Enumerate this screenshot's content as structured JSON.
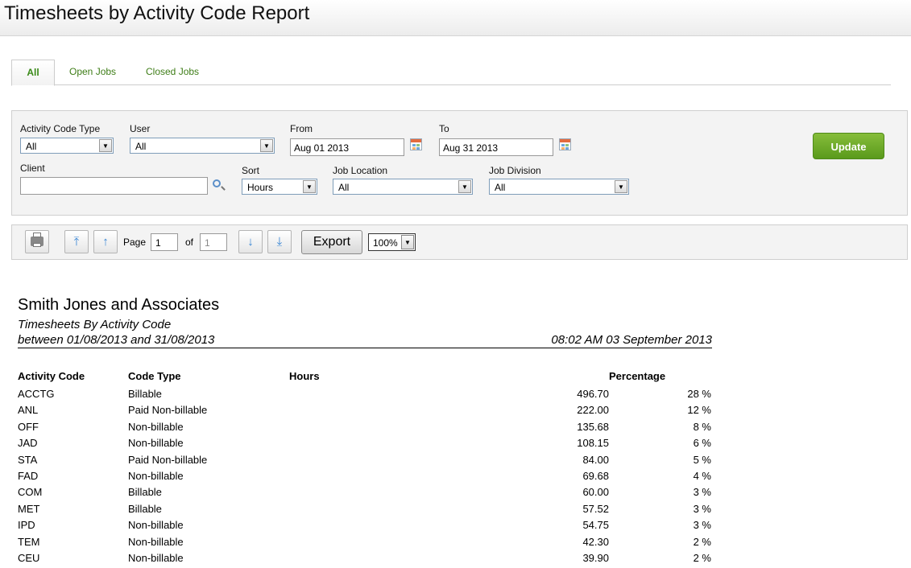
{
  "page": {
    "title": "Timesheets by Activity Code Report"
  },
  "tabs": [
    {
      "label": "All",
      "active": true
    },
    {
      "label": "Open Jobs",
      "active": false
    },
    {
      "label": "Closed Jobs",
      "active": false
    }
  ],
  "filters": {
    "activity_code_type": {
      "label": "Activity Code Type",
      "value": "All"
    },
    "user": {
      "label": "User",
      "value": "All"
    },
    "from": {
      "label": "From",
      "value": "Aug 01 2013"
    },
    "to": {
      "label": "To",
      "value": "Aug 31 2013"
    },
    "client": {
      "label": "Client",
      "value": ""
    },
    "sort": {
      "label": "Sort",
      "value": "Hours"
    },
    "job_location": {
      "label": "Job Location",
      "value": "All"
    },
    "job_division": {
      "label": "Job Division",
      "value": "All"
    },
    "update_label": "Update"
  },
  "toolbar": {
    "page_label": "Page",
    "page_value": "1",
    "of_label": "of",
    "total_pages": "1",
    "export_label": "Export",
    "zoom_value": "100%"
  },
  "report": {
    "company": "Smith Jones and Associates",
    "subtitle": "Timesheets By Activity Code",
    "range": "between 01/08/2013 and 31/08/2013",
    "generated": "08:02 AM 03 September 2013",
    "headers": {
      "activity_code": "Activity Code",
      "code_type": "Code Type",
      "hours": "Hours",
      "percentage": "Percentage"
    },
    "rows": [
      {
        "code": "ACCTG",
        "type": "Billable",
        "hours": "496.70",
        "pct": "28 %"
      },
      {
        "code": "ANL",
        "type": "Paid Non-billable",
        "hours": "222.00",
        "pct": "12 %"
      },
      {
        "code": "OFF",
        "type": "Non-billable",
        "hours": "135.68",
        "pct": "8 %"
      },
      {
        "code": "JAD",
        "type": "Non-billable",
        "hours": "108.15",
        "pct": "6 %"
      },
      {
        "code": "STA",
        "type": "Paid Non-billable",
        "hours": "84.00",
        "pct": "5 %"
      },
      {
        "code": "FAD",
        "type": "Non-billable",
        "hours": "69.68",
        "pct": "4 %"
      },
      {
        "code": "COM",
        "type": "Billable",
        "hours": "60.00",
        "pct": "3 %"
      },
      {
        "code": "MET",
        "type": "Billable",
        "hours": "57.52",
        "pct": "3 %"
      },
      {
        "code": "IPD",
        "type": "Non-billable",
        "hours": "54.75",
        "pct": "3 %"
      },
      {
        "code": "TEM",
        "type": "Non-billable",
        "hours": "42.30",
        "pct": "2 %"
      },
      {
        "code": "CEU",
        "type": "Non-billable",
        "hours": "39.90",
        "pct": "2 %"
      }
    ]
  }
}
